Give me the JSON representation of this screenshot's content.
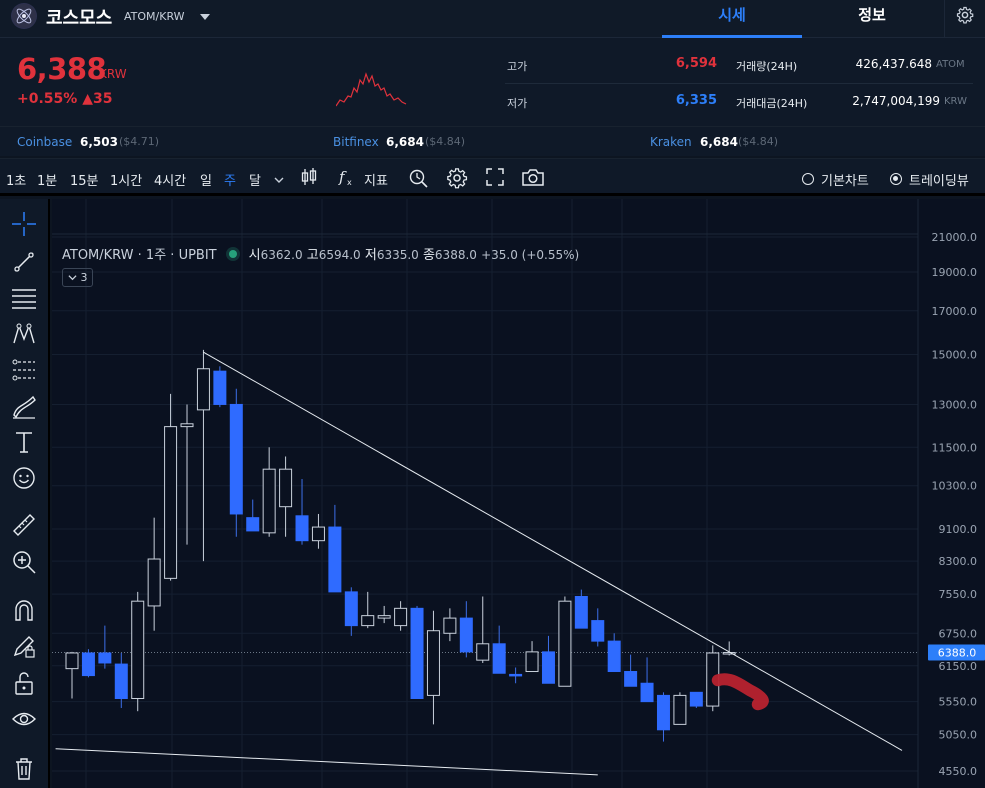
{
  "header": {
    "coin_name": "코스모스",
    "pair": "ATOM/KRW",
    "tabs": [
      {
        "label": "시세",
        "active": true
      },
      {
        "label": "정보",
        "active": false
      }
    ]
  },
  "price": {
    "current": "6,388",
    "unit": "KRW",
    "change_pct": "+0.55%",
    "change_abs": "▲35"
  },
  "stats": {
    "high_label": "고가",
    "high": "6,594",
    "low_label": "저가",
    "low": "6,335",
    "vol_label": "거래량(24H)",
    "vol": "426,437.648",
    "vol_unit": "ATOM",
    "amt_label": "거래대금(24H)",
    "amt": "2,747,004,199",
    "amt_unit": "KRW"
  },
  "exchanges": [
    {
      "name": "Coinbase",
      "price": "6,503",
      "usd": "($4.71)"
    },
    {
      "name": "Bitfinex",
      "price": "6,684",
      "usd": "($4.84)"
    },
    {
      "name": "Kraken",
      "price": "6,684",
      "usd": "($4.84)"
    }
  ],
  "toolbar": {
    "intervals": [
      "1초",
      "1분",
      "15분",
      "1시간",
      "4시간",
      "일",
      "주",
      "달"
    ],
    "active_interval": "주",
    "indicator_label": "지표",
    "view_basic": "기본차트",
    "view_tv": "트레이딩뷰"
  },
  "legend": {
    "title": "ATOM/KRW · 1주 · UPBIT",
    "o_label": "시",
    "o": "6362.0",
    "h_label": "고",
    "h": "6594.0",
    "l_label": "저",
    "l": "6335.0",
    "c_label": "종",
    "c": "6388.0",
    "chg": "+35.0 (+0.55%)",
    "collapse_count": "3"
  },
  "colors": {
    "up": "#e0323c",
    "down": "#2d7ff9",
    "accent": "#2d7ff9",
    "bg": "#0d1521"
  },
  "chart_data": {
    "type": "candlestick",
    "title": "ATOM/KRW · 1주 · UPBIT",
    "y_scale": "log",
    "yticks": [
      "21000.0",
      "19000.0",
      "17000.0",
      "15000.0",
      "13000.0",
      "11500.0",
      "10300.0",
      "9100.0",
      "8300.0",
      "7550.0",
      "6750.0",
      "6388.0",
      "6150.0",
      "5550.0",
      "5050.0",
      "4550.0"
    ],
    "last_price": 6388.0,
    "candles": [
      {
        "o": 6100,
        "h": 6400,
        "l": 5600,
        "c": 6380
      },
      {
        "o": 6380,
        "h": 6450,
        "l": 5950,
        "c": 5980
      },
      {
        "o": 6380,
        "h": 6900,
        "l": 6100,
        "c": 6200
      },
      {
        "o": 6180,
        "h": 6380,
        "l": 5450,
        "c": 5600
      },
      {
        "o": 5600,
        "h": 7600,
        "l": 5400,
        "c": 7400
      },
      {
        "o": 7300,
        "h": 9400,
        "l": 6800,
        "c": 8350
      },
      {
        "o": 7900,
        "h": 13400,
        "l": 7850,
        "c": 12200
      },
      {
        "o": 12200,
        "h": 13000,
        "l": 8700,
        "c": 12300
      },
      {
        "o": 12800,
        "h": 15200,
        "l": 8300,
        "c": 14400
      },
      {
        "o": 14300,
        "h": 14500,
        "l": 12900,
        "c": 13000
      },
      {
        "o": 13000,
        "h": 13600,
        "l": 8900,
        "c": 9500
      },
      {
        "o": 9400,
        "h": 9900,
        "l": 9050,
        "c": 9050
      },
      {
        "o": 9000,
        "h": 11500,
        "l": 8900,
        "c": 10800
      },
      {
        "o": 9700,
        "h": 11200,
        "l": 8900,
        "c": 10800
      },
      {
        "o": 9450,
        "h": 10500,
        "l": 8700,
        "c": 8800
      },
      {
        "o": 8800,
        "h": 9500,
        "l": 8600,
        "c": 9150
      },
      {
        "o": 9150,
        "h": 9750,
        "l": 7600,
        "c": 7600
      },
      {
        "o": 7600,
        "h": 7700,
        "l": 6700,
        "c": 6900
      },
      {
        "o": 6900,
        "h": 7600,
        "l": 6850,
        "c": 7100
      },
      {
        "o": 7050,
        "h": 7300,
        "l": 6950,
        "c": 7100
      },
      {
        "o": 6900,
        "h": 7400,
        "l": 6800,
        "c": 7250
      },
      {
        "o": 7250,
        "h": 7300,
        "l": 5600,
        "c": 5600
      },
      {
        "o": 5650,
        "h": 7200,
        "l": 5200,
        "c": 6800
      },
      {
        "o": 6750,
        "h": 7250,
        "l": 6600,
        "c": 7050
      },
      {
        "o": 7050,
        "h": 7400,
        "l": 6300,
        "c": 6400
      },
      {
        "o": 6250,
        "h": 7500,
        "l": 6200,
        "c": 6550
      },
      {
        "o": 6550,
        "h": 6900,
        "l": 6020,
        "c": 6020
      },
      {
        "o": 6000,
        "h": 6120,
        "l": 5850,
        "c": 5980
      },
      {
        "o": 6050,
        "h": 6600,
        "l": 6050,
        "c": 6400
      },
      {
        "o": 6400,
        "h": 6700,
        "l": 5850,
        "c": 5850
      },
      {
        "o": 5800,
        "h": 7500,
        "l": 5800,
        "c": 7400
      },
      {
        "o": 7500,
        "h": 7650,
        "l": 6850,
        "c": 6850
      },
      {
        "o": 7000,
        "h": 7250,
        "l": 6500,
        "c": 6600
      },
      {
        "o": 6600,
        "h": 6750,
        "l": 6050,
        "c": 6050
      },
      {
        "o": 6050,
        "h": 6350,
        "l": 5800,
        "c": 5800
      },
      {
        "o": 5850,
        "h": 6300,
        "l": 5550,
        "c": 5550
      },
      {
        "o": 5650,
        "h": 5700,
        "l": 4950,
        "c": 5120
      },
      {
        "o": 5200,
        "h": 5700,
        "l": 5200,
        "c": 5650
      },
      {
        "o": 5700,
        "h": 5700,
        "l": 5450,
        "c": 5480
      },
      {
        "o": 5480,
        "h": 6520,
        "l": 5400,
        "c": 6380
      },
      {
        "o": 6362,
        "h": 6594,
        "l": 6335,
        "c": 6388
      }
    ],
    "trendlines": [
      {
        "from": {
          "index": 8,
          "price": 15100
        },
        "to": {
          "index": 40,
          "price": 6400
        },
        "extend": "right"
      },
      {
        "from": {
          "index": -1,
          "price": 4850
        },
        "to": {
          "index": 32,
          "price": 4500
        }
      }
    ]
  }
}
